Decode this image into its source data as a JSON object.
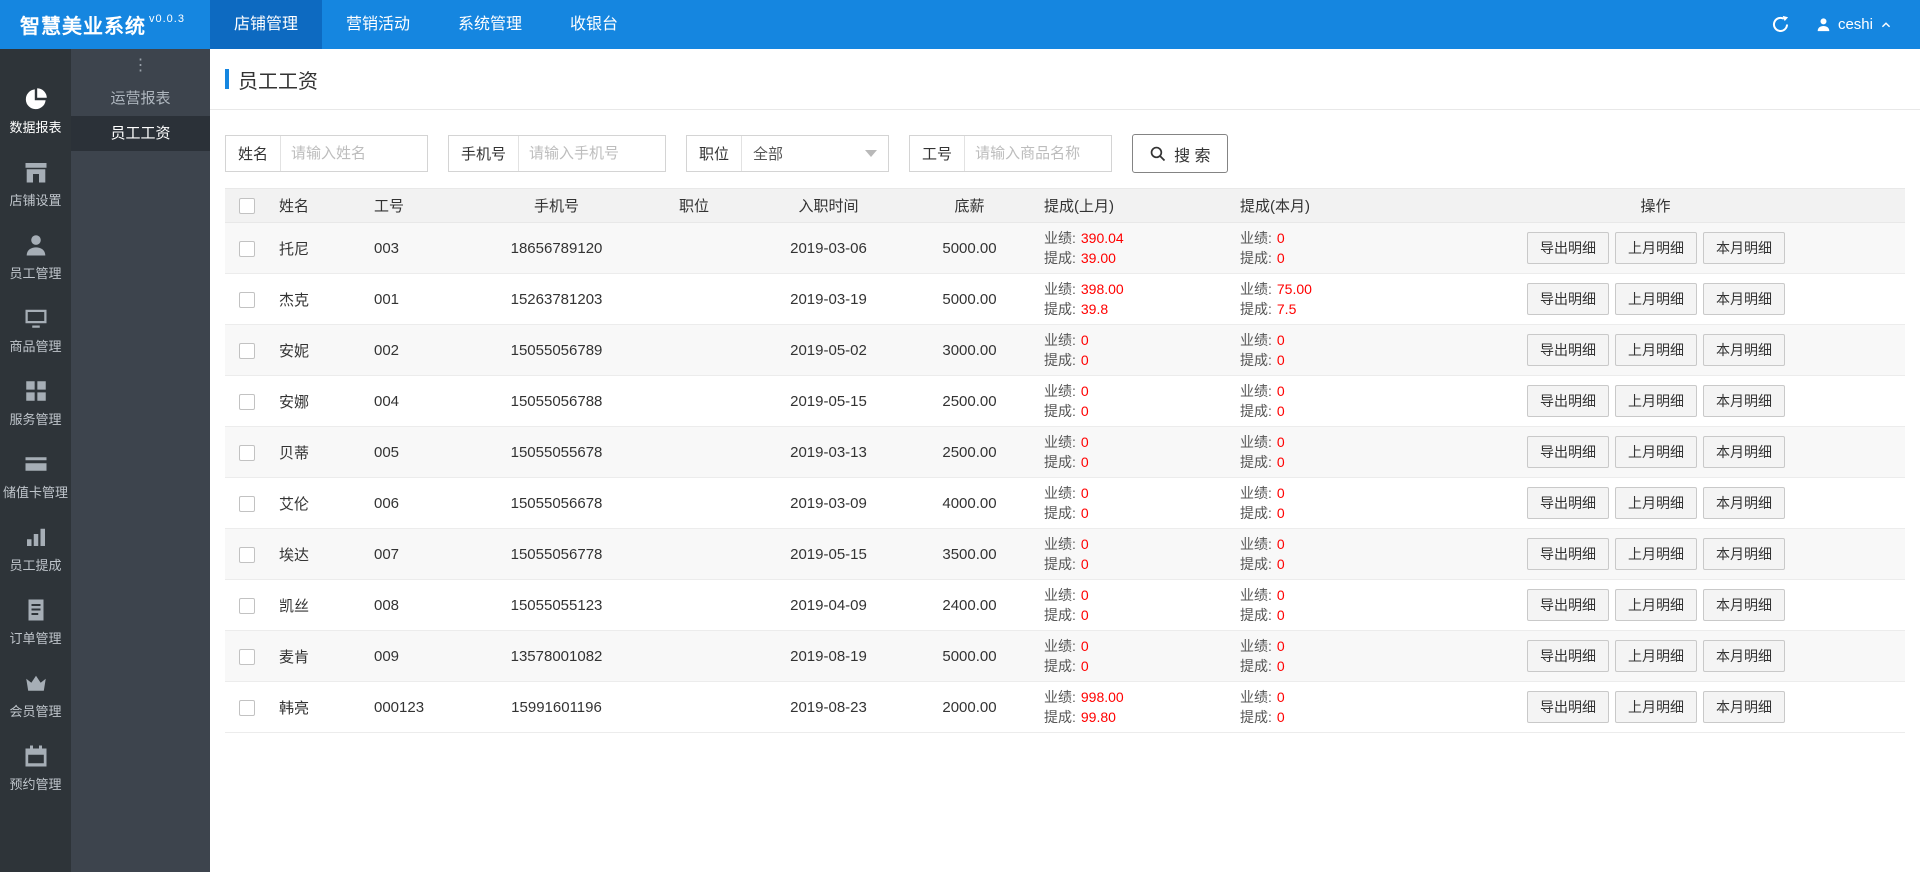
{
  "colors": {
    "accent": "#1586e0",
    "topbar_active": "#0d6ac1",
    "sidebar_dark": "#2e3439",
    "sidebar_sub": "#3d444d",
    "value_red": "#ff0000"
  },
  "topbar": {
    "logo": "智慧美业系统",
    "version": "v0.0.3",
    "nav": [
      {
        "label": "店铺管理",
        "active": true
      },
      {
        "label": "营销活动",
        "active": false
      },
      {
        "label": "系统管理",
        "active": false
      },
      {
        "label": "收银台",
        "active": false
      }
    ],
    "user": "ceshi"
  },
  "sidebar": {
    "toggle_glyph": "⋮",
    "menu": [
      {
        "id": "data-report",
        "icon": "pie-chart",
        "label": "数据报表",
        "active": true
      },
      {
        "id": "shop-settings",
        "icon": "shop",
        "label": "店铺设置",
        "active": false
      },
      {
        "id": "staff",
        "icon": "user",
        "label": "员工管理",
        "active": false
      },
      {
        "id": "goods",
        "icon": "monitor",
        "label": "商品管理",
        "active": false
      },
      {
        "id": "services",
        "icon": "grid",
        "label": "服务管理",
        "active": false
      },
      {
        "id": "value-card",
        "icon": "card",
        "label": "储值卡管理",
        "active": false
      },
      {
        "id": "commission",
        "icon": "bar-chart",
        "label": "员工提成",
        "active": false
      },
      {
        "id": "orders",
        "icon": "document",
        "label": "订单管理",
        "active": false
      },
      {
        "id": "members",
        "icon": "crown",
        "label": "会员管理",
        "active": false
      },
      {
        "id": "booking",
        "icon": "calendar",
        "label": "预约管理",
        "active": false
      }
    ],
    "submenu": [
      {
        "label": "运营报表",
        "active": false
      },
      {
        "label": "员工工资",
        "active": true
      }
    ]
  },
  "page": {
    "title": "员工工资"
  },
  "filters": {
    "name": {
      "label": "姓名",
      "placeholder": "请输入姓名",
      "value": ""
    },
    "phone": {
      "label": "手机号",
      "placeholder": "请输入手机号",
      "value": ""
    },
    "position": {
      "label": "职位",
      "value": "全部"
    },
    "job_no": {
      "label": "工号",
      "placeholder": "请输入商品名称",
      "value": ""
    },
    "search_button": "搜 索"
  },
  "table": {
    "headers": [
      "姓名",
      "工号",
      "手机号",
      "职位",
      "入职时间",
      "底薪",
      "提成(上月)",
      "提成(本月)",
      "操作"
    ],
    "labels": {
      "performance": "业绩:",
      "commission": "提成:"
    },
    "row_actions": [
      "导出明细",
      "上月明细",
      "本月明细"
    ],
    "rows": [
      {
        "name": "托尼",
        "job_no": "003",
        "phone": "18656789120",
        "position": "",
        "hire_date": "2019-03-06",
        "base_salary": "5000.00",
        "last_month": {
          "performance": "390.04",
          "commission": "39.00"
        },
        "this_month": {
          "performance": "0",
          "commission": "0"
        }
      },
      {
        "name": "杰克",
        "job_no": "001",
        "phone": "15263781203",
        "position": "",
        "hire_date": "2019-03-19",
        "base_salary": "5000.00",
        "last_month": {
          "performance": "398.00",
          "commission": "39.8"
        },
        "this_month": {
          "performance": "75.00",
          "commission": "7.5"
        }
      },
      {
        "name": "安妮",
        "job_no": "002",
        "phone": "15055056789",
        "position": "",
        "hire_date": "2019-05-02",
        "base_salary": "3000.00",
        "last_month": {
          "performance": "0",
          "commission": "0"
        },
        "this_month": {
          "performance": "0",
          "commission": "0"
        }
      },
      {
        "name": "安娜",
        "job_no": "004",
        "phone": "15055056788",
        "position": "",
        "hire_date": "2019-05-15",
        "base_salary": "2500.00",
        "last_month": {
          "performance": "0",
          "commission": "0"
        },
        "this_month": {
          "performance": "0",
          "commission": "0"
        }
      },
      {
        "name": "贝蒂",
        "job_no": "005",
        "phone": "15055055678",
        "position": "",
        "hire_date": "2019-03-13",
        "base_salary": "2500.00",
        "last_month": {
          "performance": "0",
          "commission": "0"
        },
        "this_month": {
          "performance": "0",
          "commission": "0"
        }
      },
      {
        "name": "艾伦",
        "job_no": "006",
        "phone": "15055056678",
        "position": "",
        "hire_date": "2019-03-09",
        "base_salary": "4000.00",
        "last_month": {
          "performance": "0",
          "commission": "0"
        },
        "this_month": {
          "performance": "0",
          "commission": "0"
        }
      },
      {
        "name": "埃达",
        "job_no": "007",
        "phone": "15055056778",
        "position": "",
        "hire_date": "2019-05-15",
        "base_salary": "3500.00",
        "last_month": {
          "performance": "0",
          "commission": "0"
        },
        "this_month": {
          "performance": "0",
          "commission": "0"
        }
      },
      {
        "name": "凯丝",
        "job_no": "008",
        "phone": "15055055123",
        "position": "",
        "hire_date": "2019-04-09",
        "base_salary": "2400.00",
        "last_month": {
          "performance": "0",
          "commission": "0"
        },
        "this_month": {
          "performance": "0",
          "commission": "0"
        }
      },
      {
        "name": "麦肯",
        "job_no": "009",
        "phone": "13578001082",
        "position": "",
        "hire_date": "2019-08-19",
        "base_salary": "5000.00",
        "last_month": {
          "performance": "0",
          "commission": "0"
        },
        "this_month": {
          "performance": "0",
          "commission": "0"
        }
      },
      {
        "name": "韩亮",
        "job_no": "000123",
        "phone": "15991601196",
        "position": "",
        "hire_date": "2019-08-23",
        "base_salary": "2000.00",
        "last_month": {
          "performance": "998.00",
          "commission": "99.80"
        },
        "this_month": {
          "performance": "0",
          "commission": "0"
        }
      }
    ]
  }
}
